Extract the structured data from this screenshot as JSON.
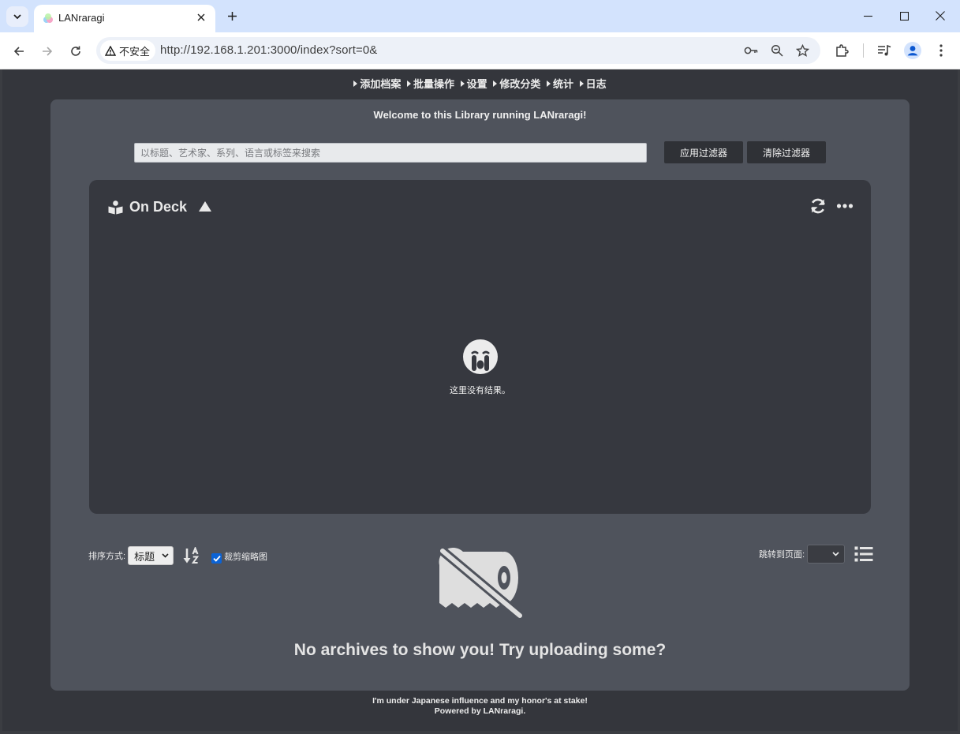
{
  "browser": {
    "tab_title": "LANraragi",
    "security_label": "不安全",
    "url": "http://192.168.1.201:3000/index?sort=0&"
  },
  "nav": {
    "items": [
      "添加档案",
      "批量操作",
      "设置",
      "修改分类",
      "统计",
      "日志"
    ]
  },
  "welcome": "Welcome to this Library running LANraragi!",
  "search": {
    "placeholder": "以标题、艺术家、系列、语言或标签来搜索",
    "apply_label": "应用过滤器",
    "clear_label": "清除过滤器"
  },
  "ondeck": {
    "title": "On Deck",
    "empty_text": "这里没有结果。"
  },
  "sort": {
    "label": "排序方式:",
    "selected": "标题",
    "crop_label": "裁剪缩略图",
    "crop_checked": true
  },
  "pagejump": {
    "label": "跳转到页面:"
  },
  "empty": {
    "message": "No archives to show you! Try uploading some?"
  },
  "footer": {
    "line1": "I'm under Japanese influence and my honor's at stake!",
    "line2": "Powered by LANraragi."
  },
  "colors": {
    "accent": "#0b63d6",
    "panel": "#4f535c",
    "page_bg": "#34363c"
  }
}
